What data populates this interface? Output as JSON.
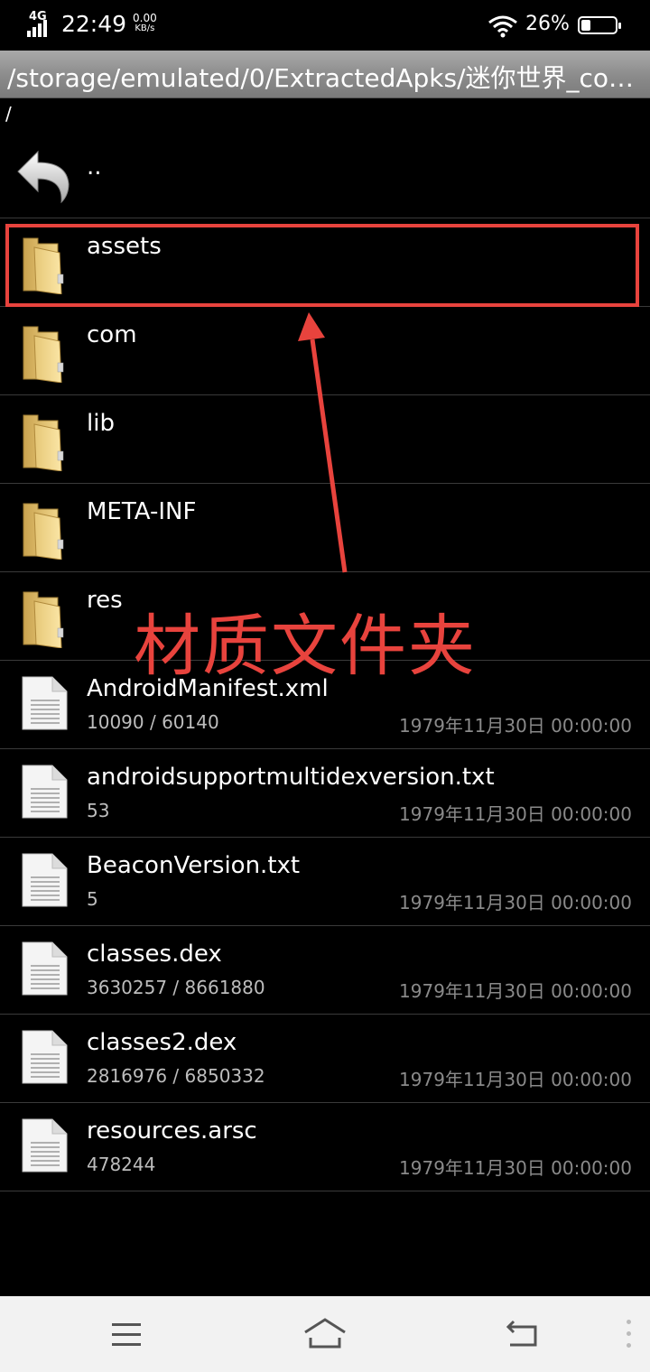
{
  "status": {
    "network": "4G",
    "time": "22:49",
    "speed_value": "0.00",
    "speed_unit": "KB/s",
    "battery": "26%"
  },
  "path_bar": {
    "path": "/storage/emulated/0/ExtractedApks/迷你世界_co…"
  },
  "subpath": "/",
  "parent_row": {
    "label": ".."
  },
  "rows": [
    {
      "name": "assets",
      "type": "folder"
    },
    {
      "name": "com",
      "type": "folder"
    },
    {
      "name": "lib",
      "type": "folder"
    },
    {
      "name": "META-INF",
      "type": "folder"
    },
    {
      "name": "res",
      "type": "folder"
    },
    {
      "name": "AndroidManifest.xml",
      "type": "file",
      "size": "10090 / 60140",
      "date": "1979年11月30日 00:00:00"
    },
    {
      "name": "androidsupportmultidexversion.txt",
      "type": "file",
      "size": "53",
      "date": "1979年11月30日 00:00:00"
    },
    {
      "name": "BeaconVersion.txt",
      "type": "file",
      "size": "5",
      "date": "1979年11月30日 00:00:00"
    },
    {
      "name": "classes.dex",
      "type": "file",
      "size": "3630257 / 8661880",
      "date": "1979年11月30日 00:00:00"
    },
    {
      "name": "classes2.dex",
      "type": "file",
      "size": "2816976 / 6850332",
      "date": "1979年11月30日 00:00:00"
    },
    {
      "name": "resources.arsc",
      "type": "file",
      "size": "478244",
      "date": "1979年11月30日 00:00:00"
    }
  ],
  "annotation": {
    "text": "材质文件夹",
    "color": "#e8433d"
  },
  "icons": {
    "back": "back-arrow-icon",
    "folder": "folder-icon",
    "file": "file-icon",
    "menu": "menu-icon",
    "home": "home-icon",
    "return": "return-icon"
  }
}
